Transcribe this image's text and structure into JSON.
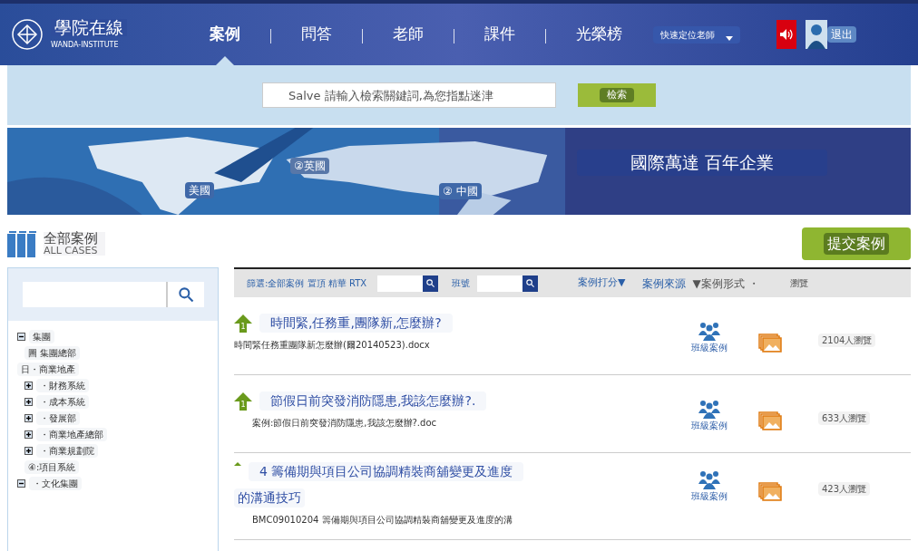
{
  "header": {
    "logo_text": "學院在線",
    "logo_subtext": "WANDA-INSTITUTE",
    "nav": [
      {
        "label": "案例",
        "selected": true
      },
      {
        "label": "問答",
        "selected": false
      },
      {
        "label": "老師",
        "selected": false
      },
      {
        "label": "課件",
        "selected": false
      },
      {
        "label": "光榮榜",
        "selected": false
      }
    ],
    "teacher_dropdown": "快速定位老師",
    "logout": "退出"
  },
  "search": {
    "placeholder": "Salve 請輸入檢索關鍵詞,為您指點迷津",
    "button": "檢索"
  },
  "banner": {
    "labels": [
      "②英國",
      "美國",
      "② 中國"
    ],
    "slogan": "國際萬達 百年企業"
  },
  "section": {
    "title": "全部案例",
    "subtitle": "ALL CASES",
    "submit": "提交案例"
  },
  "sidebar": {
    "tree": [
      {
        "label": "集團",
        "expanded": true,
        "children": [
          {
            "label": "圖 集團總部"
          }
        ]
      },
      {
        "label": "日・商業地產",
        "children": [
          {
            "label": "・財務系統",
            "expanded": false
          },
          {
            "label": "・成本系統",
            "expanded": false
          },
          {
            "label": "・發展部",
            "expanded": false
          },
          {
            "label": "・商業地產總部",
            "expanded": false
          },
          {
            "label": "・商業規劃院",
            "expanded": false
          },
          {
            "label": "④:項目系統"
          }
        ]
      },
      {
        "label": "・文化集團",
        "expanded": true
      }
    ]
  },
  "filter_bar": {
    "filter": "篩選:全部案例 置頂 精華 RTX",
    "class_label": "班號",
    "columns": [
      "案例打分▼",
      "案例來源",
      "▼案例形式 ・",
      "瀏覽"
    ]
  },
  "rows": [
    {
      "rank": "1",
      "title": "時間緊,任務重,團隊新,怎麼辦?",
      "file": "時間緊任務重團隊新怎麼辦(爾20140523).docx",
      "source": "班級案例",
      "views": "2104人瀏覽"
    },
    {
      "rank": "1",
      "title": "節假日前突發消防隱患,我該怎麼辦?.",
      "file": "案例:節假日前突發消防隱患,我該怎麼辦?.doc",
      "source": "班級案例",
      "views": "633人瀏覽"
    },
    {
      "title": "4 籌備期與項目公司協調精裝商舖變更及進度",
      "title_line2": "的溝通技巧",
      "file": "BMC09010204 籌備期與項目公司協調精裝商舖變更及進度的溝",
      "source": "班級案例",
      "views": "423人瀏覽"
    }
  ]
}
